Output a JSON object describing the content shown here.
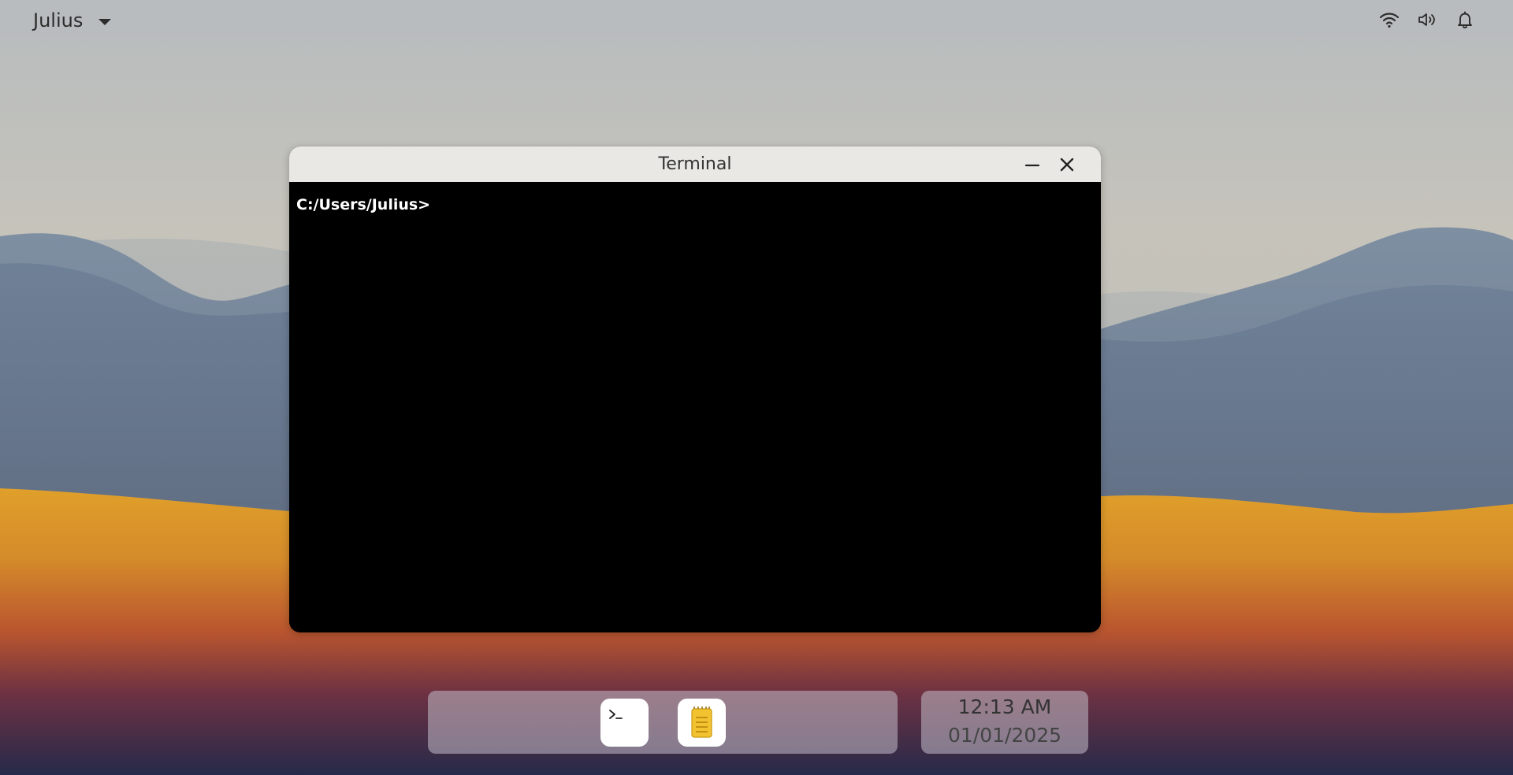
{
  "topbar": {
    "user_name": "Julius",
    "tray_icons": [
      "wifi-icon",
      "volume-icon",
      "bell-icon"
    ]
  },
  "window": {
    "title": "Terminal",
    "prompt": "C:/Users/Julius>"
  },
  "dock": {
    "apps": [
      "terminal-app",
      "notes-app"
    ]
  },
  "clock": {
    "time": "12:13 AM",
    "date": "01/01/2025"
  },
  "colors": {
    "terminal_bg": "#000000",
    "titlebar_bg": "#e9e8e4",
    "notes_accent": "#f2c230"
  }
}
